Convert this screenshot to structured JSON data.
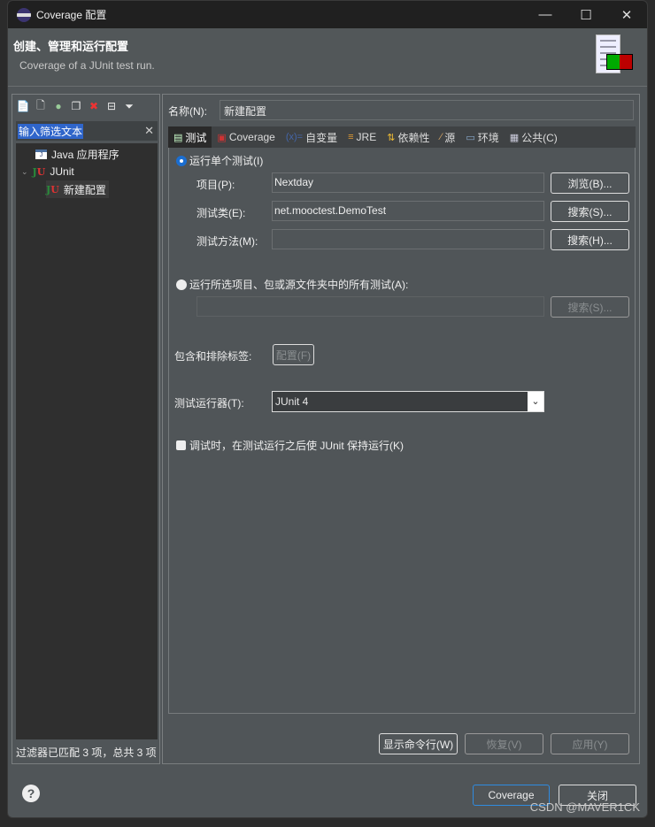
{
  "window": {
    "title": "Coverage 配置",
    "minimize": "—",
    "maximize": "☐",
    "close": "✕"
  },
  "header": {
    "title": "创建、管理和运行配置",
    "subtitle": "Coverage of a JUnit test run."
  },
  "left": {
    "filter_text": "输入筛选文本",
    "tree": [
      {
        "label": "Java 应用程序"
      },
      {
        "label": "JUnit"
      },
      {
        "label": "新建配置"
      }
    ],
    "status": "过滤器已匹配 3 项，总共 3 项"
  },
  "form": {
    "name_label": "名称(N):",
    "name_value": "新建配置",
    "tabs": [
      {
        "label": "测试"
      },
      {
        "label": "Coverage"
      },
      {
        "label": "自变量"
      },
      {
        "label": "JRE"
      },
      {
        "label": "依赖性"
      },
      {
        "label": "源"
      },
      {
        "label": "环境"
      },
      {
        "label": "公共(C)"
      }
    ],
    "single_test": "运行单个测试(I)",
    "project_label": "项目(P):",
    "project_value": "Nextday",
    "browse": "浏览(B)...",
    "class_label": "测试类(E):",
    "class_value": "net.mooctest.DemoTest",
    "search_s": "搜索(S)...",
    "method_label": "测试方法(M):",
    "method_value": "",
    "search_h": "搜索(H)...",
    "all_tests": "运行所选项目、包或源文件夹中的所有测试(A):",
    "all_search": "搜索(S)...",
    "tags_label": "包含和排除标签:",
    "tags_button": "配置(F)",
    "runner_label": "测试运行器(T):",
    "runner_value": "JUnit 4",
    "keep_running": "调试时，在测试运行之后使 JUnit 保持运行(K)",
    "show_cmd": "显示命令行(W)",
    "revert": "恢复(V)",
    "apply": "应用(Y)"
  },
  "footer": {
    "run": "Coverage",
    "close": "关闭",
    "watermark": "CSDN @MAVER1CK"
  }
}
